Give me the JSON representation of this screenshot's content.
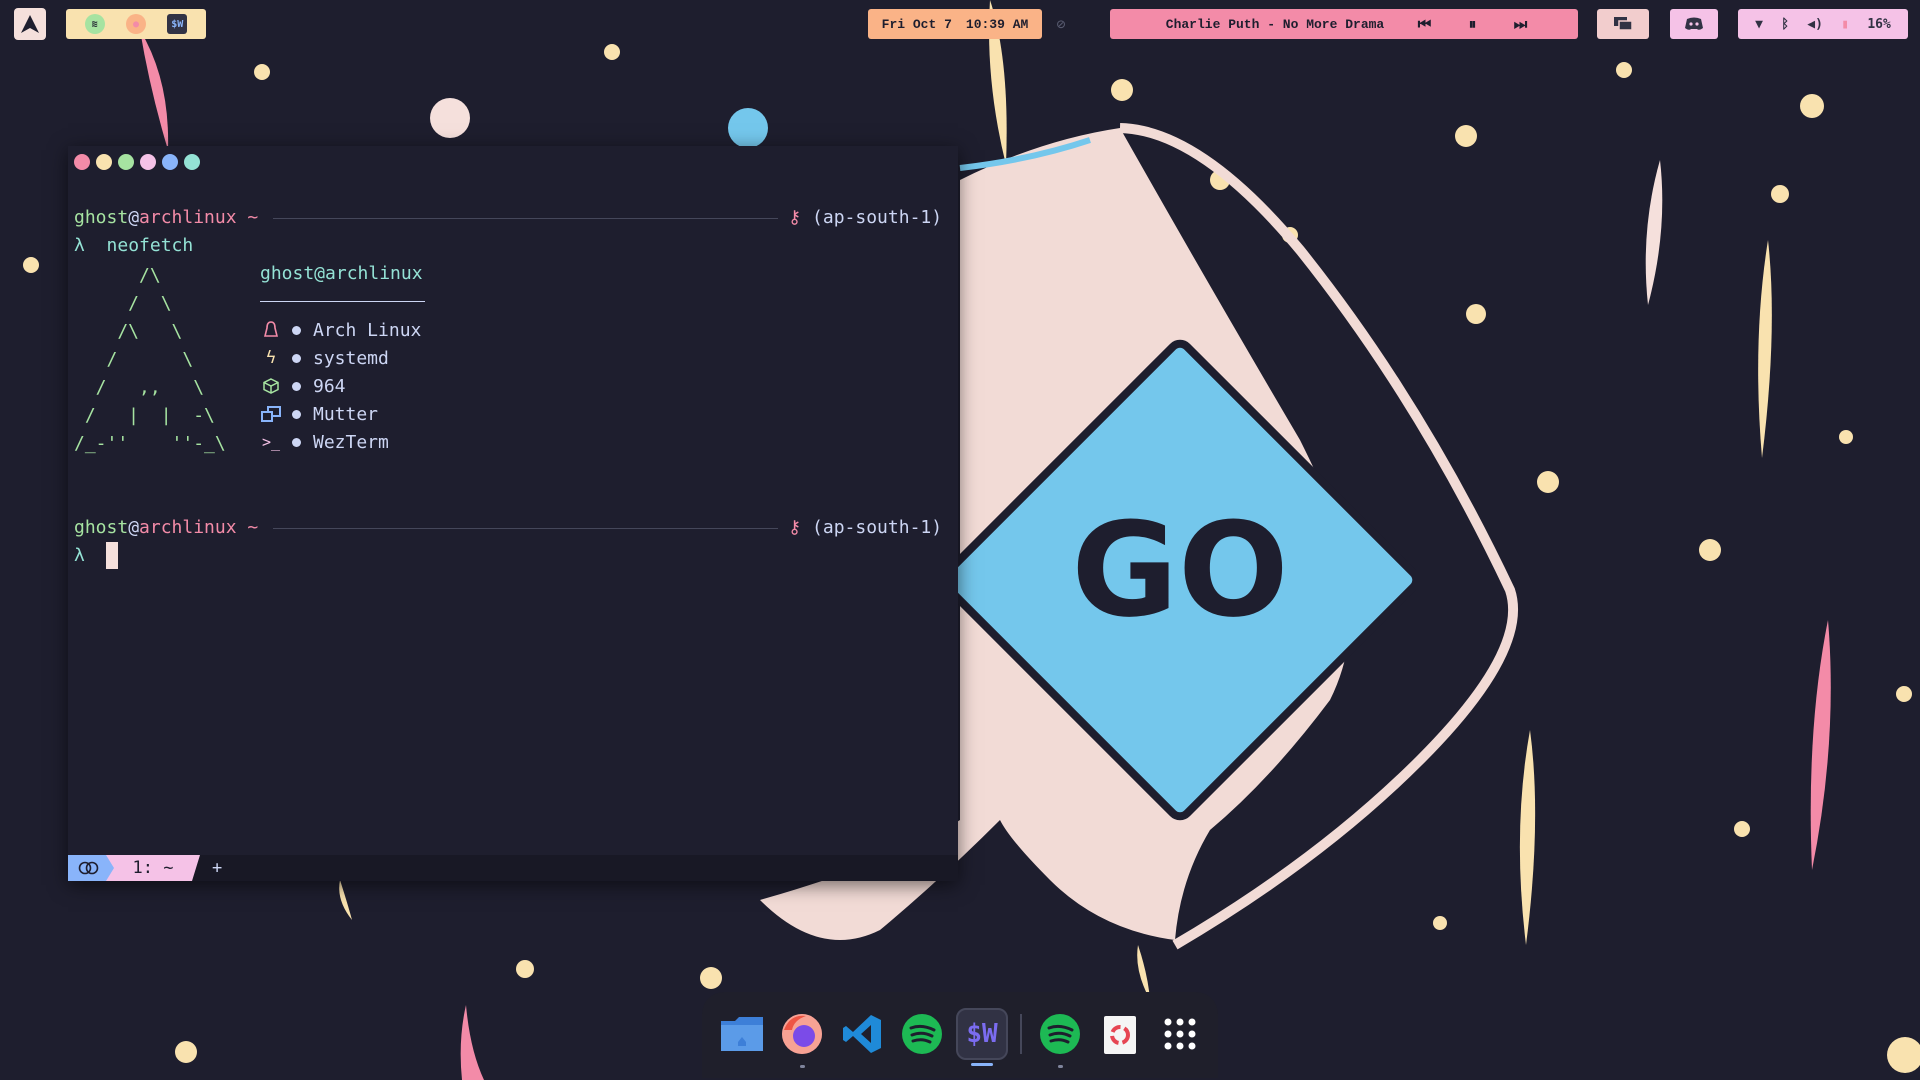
{
  "topbar": {
    "launcher_icon": "arch-logo-icon",
    "running_apps": [
      {
        "icon": "spotify-icon",
        "color": "#a6e3a1"
      },
      {
        "icon": "firefox-icon",
        "color": "#fab387"
      },
      {
        "icon": "wezterm-icon",
        "color": "#313244",
        "glyph": "$W"
      }
    ],
    "clock": {
      "date": "Fri Oct 7",
      "time": "10:39 AM"
    },
    "dnd_icon": "notifications-off-icon",
    "media": {
      "title": "Charlie Puth - No More Drama",
      "prev_icon": "skip-previous-icon",
      "pause_icon": "pause-icon",
      "next_icon": "skip-next-icon"
    },
    "screen_icon": "screen-share-icon",
    "discord_icon": "discord-icon",
    "tray": {
      "wifi_icon": "wifi-icon",
      "bluetooth_icon": "bluetooth-icon",
      "volume_icon": "volume-icon",
      "battery_icon": "battery-icon",
      "battery_percent": "16%"
    }
  },
  "colors": {
    "background": "#1e1e2e",
    "pink": "#f38ba8",
    "green": "#a6e3a1",
    "peach": "#fab387",
    "yellow": "#f9e2af",
    "blue": "#89b4fa",
    "teal": "#94e2d5",
    "mauve": "#f5c2e7",
    "sky": "#74c7ec",
    "rosewater": "#f5e0dc"
  },
  "terminal": {
    "window_dots": [
      "#f38ba8",
      "#f9e2af",
      "#a6e3a1",
      "#f5c2e7",
      "#89b4fa",
      "#94e2d5"
    ],
    "prompt": {
      "user": "ghost",
      "at": "@",
      "host": "archlinux",
      "dir": "~",
      "aws_region": "(ap-south-1)",
      "lambda": "λ"
    },
    "command": "neofetch",
    "ascii_art": "      /\\\n     /  \\\n    /\\   \\\n   /      \\\n  /   ,,   \\\n /   |  |  -\\\n/_-''    ''-_\\",
    "neofetch": {
      "title": "ghost@archlinux",
      "rows": [
        {
          "icon": "linux-penguin-icon",
          "value": "Arch Linux",
          "color": "#f38ba8"
        },
        {
          "icon": "init-bolt-icon",
          "value": "systemd",
          "color": "#f9e2af"
        },
        {
          "icon": "package-icon",
          "value": "964",
          "color": "#a6e3a1"
        },
        {
          "icon": "window-manager-icon",
          "value": "Mutter",
          "color": "#89b4fa"
        },
        {
          "icon": "terminal-icon",
          "value": "WezTerm",
          "color": "#f5c2e7"
        }
      ]
    },
    "tab": {
      "label": "1: ~",
      "new_tab": "+"
    }
  },
  "dock": {
    "apps": [
      {
        "name": "files",
        "icon": "files-icon"
      },
      {
        "name": "firefox",
        "icon": "firefox-icon"
      },
      {
        "name": "vscode",
        "icon": "vscode-icon"
      },
      {
        "name": "spotify",
        "icon": "spotify-icon"
      },
      {
        "name": "wezterm",
        "icon": "wezterm-icon",
        "glyph": "$W"
      },
      {
        "name": "spotify-running",
        "icon": "spotify-icon"
      },
      {
        "name": "trash",
        "icon": "trash-icon"
      },
      {
        "name": "show-apps",
        "icon": "app-grid-icon"
      }
    ]
  }
}
